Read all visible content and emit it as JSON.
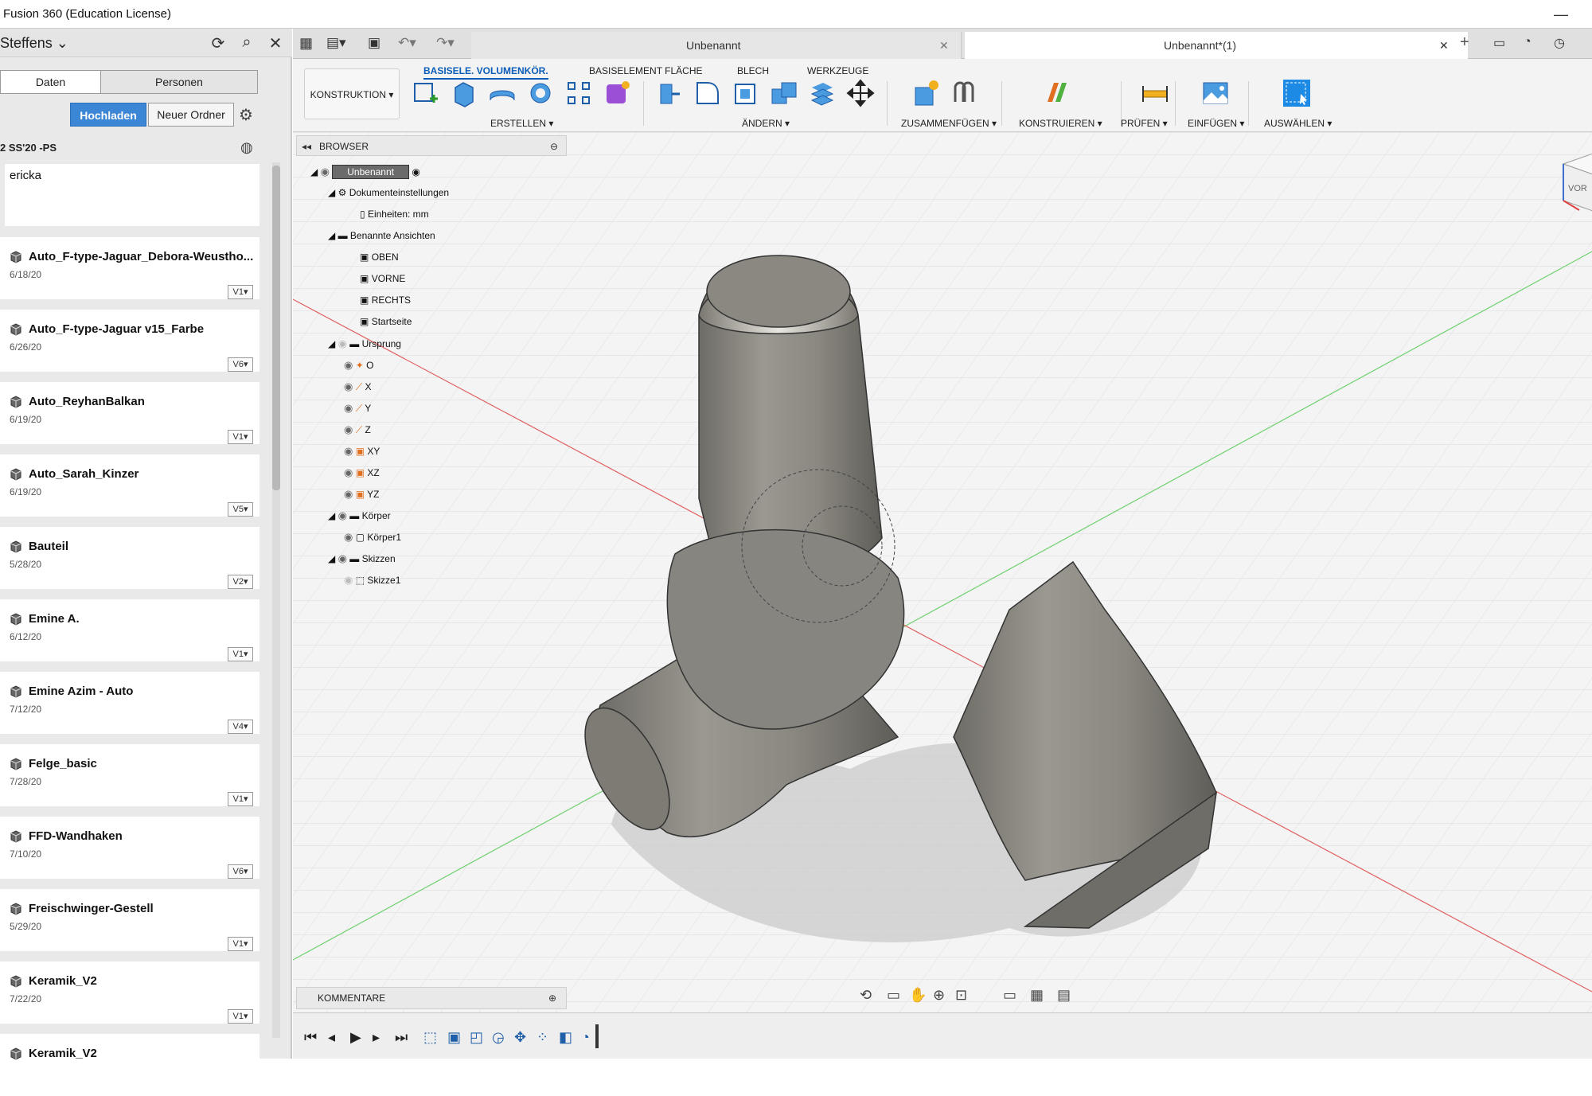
{
  "window": {
    "title": "Fusion 360 (Education License)"
  },
  "data_panel": {
    "project": "Steffens",
    "tabs": [
      "Daten",
      "Personen"
    ],
    "upload_label": "Hochladen",
    "new_folder_label": "Neuer Ordner",
    "folder_path": "2 SS'20 -PS",
    "note_text": "ericka",
    "items": [
      {
        "name": "Auto_F-type-Jaguar_Debora-Weustho...",
        "date": "6/18/20",
        "version": "V1"
      },
      {
        "name": "Auto_F-type-Jaguar v15_Farbe",
        "date": "6/26/20",
        "version": "V6"
      },
      {
        "name": "Auto_ReyhanBalkan",
        "date": "6/19/20",
        "version": "V1"
      },
      {
        "name": "Auto_Sarah_Kinzer",
        "date": "6/19/20",
        "version": "V5"
      },
      {
        "name": "Bauteil",
        "date": "5/28/20",
        "version": "V2"
      },
      {
        "name": "Emine A.",
        "date": "6/12/20",
        "version": "V1"
      },
      {
        "name": "Emine Azim - Auto",
        "date": "7/12/20",
        "version": "V4"
      },
      {
        "name": "Felge_basic",
        "date": "7/28/20",
        "version": "V1"
      },
      {
        "name": "FFD-Wandhaken",
        "date": "7/10/20",
        "version": "V6"
      },
      {
        "name": "Freischwinger-Gestell",
        "date": "5/29/20",
        "version": "V1"
      },
      {
        "name": "Keramik_V2",
        "date": "7/22/20",
        "version": "V1"
      },
      {
        "name": "Keramik_V2",
        "date": "",
        "version": ""
      }
    ]
  },
  "doc_tabs": [
    {
      "label": "Unbenannt"
    },
    {
      "label": "Unbenannt*(1)"
    }
  ],
  "toolbar": {
    "workspace": "KONSTRUKTION ▾",
    "tabs": [
      "BASISELE. VOLUMENKÖR.",
      "BASISELEMENT FLÄCHE",
      "BLECH",
      "WERKZEUGE"
    ],
    "groups": [
      "ERSTELLEN ▾",
      "ÄNDERN ▾",
      "ZUSAMMENFÜGEN ▾",
      "KONSTRUIEREN ▾",
      "PRÜFEN ▾",
      "EINFÜGEN ▾",
      "AUSWÄHLEN ▾"
    ]
  },
  "browser": {
    "title": "BROWSER",
    "root": "Unbenannt",
    "doc_settings": "Dokumenteinstellungen",
    "units": "Einheiten: mm",
    "named_views": "Benannte Ansichten",
    "views": [
      "OBEN",
      "VORNE",
      "RECHTS",
      "Startseite"
    ],
    "origin": "Ursprung",
    "origin_items": [
      "O",
      "X",
      "Y",
      "Z",
      "XY",
      "XZ",
      "YZ"
    ],
    "bodies": "Körper",
    "body1": "Körper1",
    "sketches": "Skizzen",
    "sketch1": "Skizze1"
  },
  "comments_label": "KOMMENTARE",
  "viewcube": {
    "label": "VOR"
  },
  "colors": {
    "accent": "#0b5db8",
    "upload": "#3c86d6",
    "model": "#8a8880"
  }
}
